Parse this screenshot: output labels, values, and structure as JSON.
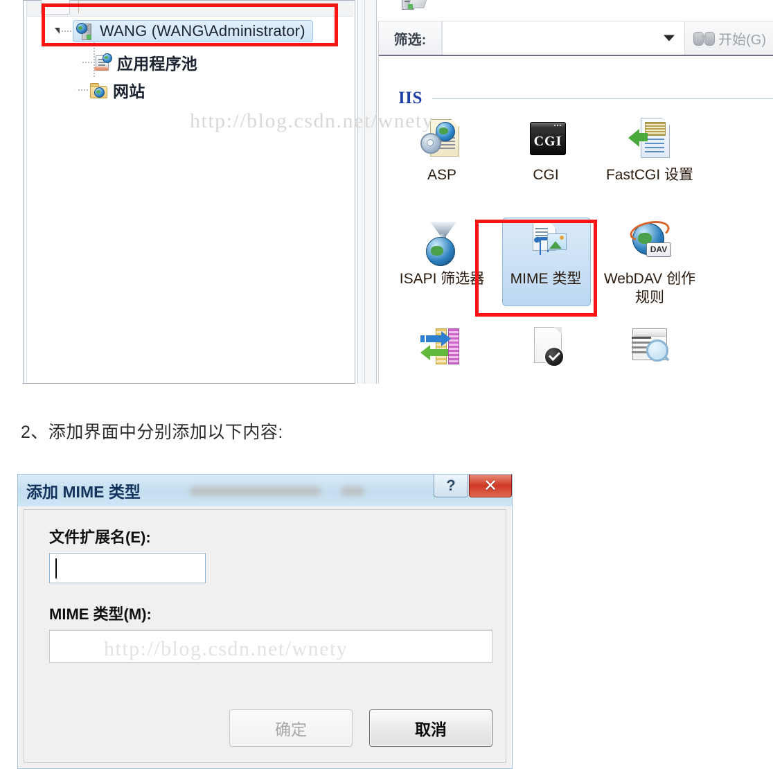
{
  "screenshot": {
    "tree": {
      "items": [
        {
          "label": "WANG (WANG\\Administrator)",
          "icon": "server-icon",
          "selected": true,
          "expander": "expanded"
        },
        {
          "label": "应用程序池",
          "icon": "application-pool-icon",
          "selected": false,
          "expander": "none"
        },
        {
          "label": "网站",
          "icon": "sites-folder-icon",
          "selected": false,
          "expander": "collapsed"
        }
      ]
    },
    "toolbar": {
      "filter_label": "筛选:",
      "filter_value": "",
      "go_label": "开始(G)",
      "go_accel": "G",
      "go_icon": "binoculars-icon",
      "dropdown_icon": "chevron-down-icon"
    },
    "feature_view": {
      "section_title": "IIS",
      "icons": [
        {
          "label": "ASP",
          "icon": "asp-icon",
          "selected": false
        },
        {
          "label": "CGI",
          "icon": "cgi-icon",
          "selected": false
        },
        {
          "label": "FastCGI 设置",
          "icon": "fastcgi-settings-icon",
          "selected": false
        },
        {
          "label": "ISAPI 筛选器",
          "icon": "isapi-filters-icon",
          "selected": false
        },
        {
          "label": "MIME 类型",
          "icon": "mime-types-icon",
          "selected": true
        },
        {
          "label": "WebDAV 创作规则",
          "icon": "webdav-authoring-rules-icon",
          "selected": false
        },
        {
          "label": "",
          "icon": "http-redirect-icon",
          "selected": false
        },
        {
          "label": "",
          "icon": "default-document-icon",
          "selected": false
        },
        {
          "label": "",
          "icon": "request-filtering-icon",
          "selected": false
        }
      ],
      "webdav_badge": "DAV"
    },
    "watermark": "http://blog.csdn.net/wnety",
    "highlight_color": "#fc1414"
  },
  "caption": "2、添加界面中分别添加以下内容:",
  "dialog": {
    "title": "添加 MIME 类型",
    "help_button": "?",
    "close_button": "✕",
    "fields": [
      {
        "label": "文件扩展名(E):",
        "accel": "E",
        "value": "",
        "focused": true
      },
      {
        "label": "MIME 类型(M):",
        "accel": "M",
        "value": "",
        "focused": false
      }
    ],
    "buttons": [
      {
        "label": "确定",
        "disabled": true
      },
      {
        "label": "取消",
        "disabled": false,
        "default_focus": true
      }
    ],
    "watermark": "http://blog.csdn.net/wnety"
  }
}
